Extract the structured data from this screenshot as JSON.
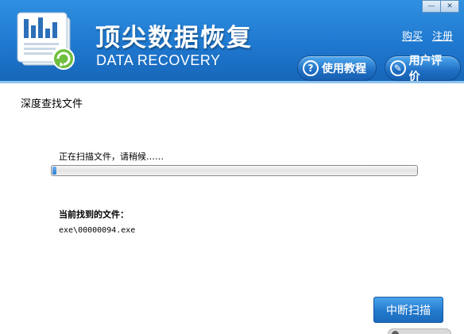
{
  "window": {
    "controls": {
      "minimize_glyph": "—",
      "close_glyph": "✕"
    }
  },
  "header": {
    "title": "顶尖数据恢复",
    "subtitle": "DATA RECOVERY",
    "links": [
      {
        "label": "购买"
      },
      {
        "label": "注册"
      }
    ],
    "buttons": [
      {
        "label": "使用教程",
        "icon": "question-circle-icon",
        "icon_glyph": "?"
      },
      {
        "label": "用户评价",
        "icon": "feedback-icon",
        "icon_glyph": "✎"
      }
    ]
  },
  "main": {
    "section_title": "深度查找文件",
    "scan_status": "正在扫描文件，请稍候……",
    "progress": 0.01,
    "found_label": "当前找到的文件：",
    "found_file": "exe\\00000094.exe",
    "stop_button": "中断扫描"
  },
  "colors": {
    "header_bg": "#1f78cf",
    "button_blue": "#237acd",
    "progress_fill": "#2b7fd3"
  }
}
